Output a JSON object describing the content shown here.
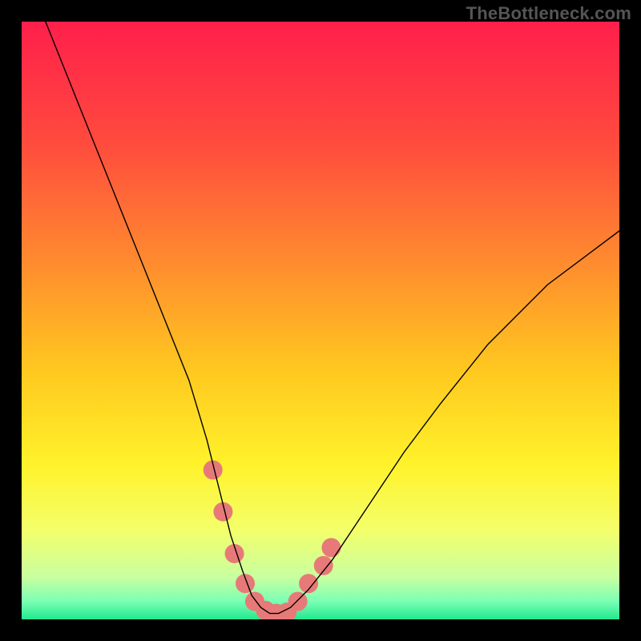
{
  "attribution": "TheBottleneck.com",
  "chart_data": {
    "type": "line",
    "title": "",
    "xlabel": "",
    "ylabel": "",
    "xlim": [
      0,
      100
    ],
    "ylim": [
      0,
      100
    ],
    "grid": false,
    "legend": false,
    "annotations": [],
    "background": {
      "type": "vertical_gradient",
      "stops": [
        {
          "offset": 0.0,
          "color": "#ff1f4b"
        },
        {
          "offset": 0.2,
          "color": "#ff4a3e"
        },
        {
          "offset": 0.4,
          "color": "#ff8a2f"
        },
        {
          "offset": 0.58,
          "color": "#ffc71f"
        },
        {
          "offset": 0.74,
          "color": "#fff22a"
        },
        {
          "offset": 0.85,
          "color": "#f4ff6a"
        },
        {
          "offset": 0.93,
          "color": "#c8ffa0"
        },
        {
          "offset": 0.97,
          "color": "#7affb4"
        },
        {
          "offset": 1.0,
          "color": "#22e88f"
        }
      ]
    },
    "series": [
      {
        "name": "bottleneck-curve",
        "stroke": "#000000",
        "stroke_width": 1.4,
        "x": [
          4,
          8,
          12,
          16,
          20,
          24,
          28,
          31,
          33,
          35,
          37,
          38.5,
          40,
          41.5,
          43,
          45,
          48,
          52,
          56,
          60,
          64,
          70,
          78,
          88,
          100
        ],
        "y": [
          100,
          90,
          80,
          70,
          60,
          50,
          40,
          30,
          22,
          14,
          8,
          4,
          2,
          1,
          1,
          2,
          5,
          10,
          16,
          22,
          28,
          36,
          46,
          56,
          65
        ]
      }
    ],
    "highlights": {
      "name": "curve-highlight-dots",
      "fill": "#e77a78",
      "radius": 12,
      "points": [
        {
          "x": 32.0,
          "y": 25
        },
        {
          "x": 33.7,
          "y": 18
        },
        {
          "x": 35.6,
          "y": 11
        },
        {
          "x": 37.4,
          "y": 6
        },
        {
          "x": 39.0,
          "y": 3
        },
        {
          "x": 40.8,
          "y": 1.5
        },
        {
          "x": 42.6,
          "y": 1
        },
        {
          "x": 44.4,
          "y": 1.2
        },
        {
          "x": 46.2,
          "y": 3
        },
        {
          "x": 48.0,
          "y": 6
        },
        {
          "x": 50.5,
          "y": 9
        },
        {
          "x": 51.8,
          "y": 12
        }
      ]
    }
  }
}
